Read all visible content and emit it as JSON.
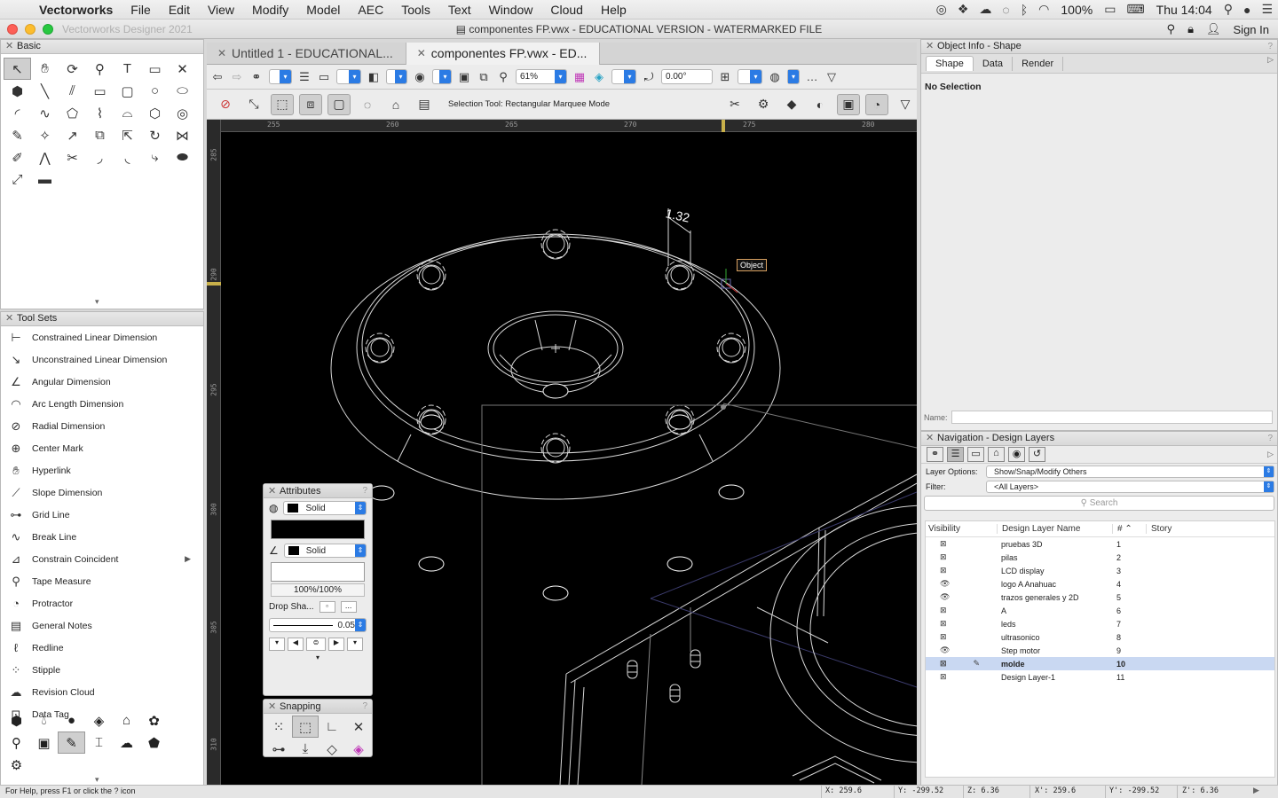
{
  "menubar": {
    "app": "Vectorworks",
    "items": [
      "File",
      "Edit",
      "View",
      "Modify",
      "Model",
      "AEC",
      "Tools",
      "Text",
      "Window",
      "Cloud",
      "Help"
    ],
    "battery": "100%",
    "clock": "Thu 14:04"
  },
  "titlebar": {
    "app_name": "Vectorworks Designer 2021",
    "doc_title": "componentes FP.vwx - EDUCATIONAL VERSION - WATERMARKED FILE",
    "sign_in": "Sign In"
  },
  "basic_palette": {
    "title": "Basic"
  },
  "toolsets": {
    "title": "Tool Sets",
    "items": [
      {
        "label": "Constrained Linear Dimension",
        "icon": "constrained-dimension-icon"
      },
      {
        "label": "Unconstrained Linear Dimension",
        "icon": "unconstrained-dimension-icon"
      },
      {
        "label": "Angular Dimension",
        "icon": "angular-dimension-icon"
      },
      {
        "label": "Arc Length Dimension",
        "icon": "arc-length-icon"
      },
      {
        "label": "Radial Dimension",
        "icon": "radial-dimension-icon"
      },
      {
        "label": "Center Mark",
        "icon": "center-mark-icon"
      },
      {
        "label": "Hyperlink",
        "icon": "hyperlink-icon"
      },
      {
        "label": "Slope Dimension",
        "icon": "slope-dimension-icon"
      },
      {
        "label": "Grid Line",
        "icon": "grid-line-icon"
      },
      {
        "label": "Break Line",
        "icon": "break-line-icon"
      },
      {
        "label": "Constrain Coincident",
        "icon": "constrain-icon"
      },
      {
        "label": "Tape Measure",
        "icon": "tape-measure-icon"
      },
      {
        "label": "Protractor",
        "icon": "protractor-icon"
      },
      {
        "label": "General Notes",
        "icon": "notes-icon"
      },
      {
        "label": "Redline",
        "icon": "redline-icon"
      },
      {
        "label": "Stipple",
        "icon": "stipple-icon"
      },
      {
        "label": "Revision Cloud",
        "icon": "revision-cloud-icon"
      },
      {
        "label": "Data Tag",
        "icon": "data-tag-icon"
      }
    ]
  },
  "tabs": [
    {
      "label": "Untitled 1 - EDUCATIONAL...",
      "active": false
    },
    {
      "label": "componentes FP.vwx - ED...",
      "active": true
    }
  ],
  "viewbar": {
    "zoom": "61%",
    "rotation": "0.00°"
  },
  "modebar": {
    "mode_text": "Selection Tool: Rectangular Marquee Mode"
  },
  "rulers": {
    "h": [
      "255",
      "260",
      "265",
      "270",
      "275",
      "280"
    ],
    "v": [
      "285",
      "290",
      "295",
      "300",
      "305",
      "310"
    ]
  },
  "canvas": {
    "dim_label": "1.32",
    "object_tip": "Object"
  },
  "attributes": {
    "title": "Attributes",
    "fill_style": "Solid",
    "pen_style": "Solid",
    "opacity": "100%/100%",
    "drop_shadow": "Drop Sha...",
    "drop_more": "...",
    "line_weight": "0.05"
  },
  "snapping": {
    "title": "Snapping"
  },
  "object_info": {
    "title": "Object Info - Shape",
    "tabs": [
      "Shape",
      "Data",
      "Render"
    ],
    "active_tab": "Shape",
    "status": "No Selection",
    "name_label": "Name:"
  },
  "navigation": {
    "title": "Navigation - Design Layers",
    "layer_options_label": "Layer Options:",
    "layer_options_value": "Show/Snap/Modify Others",
    "filter_label": "Filter:",
    "filter_value": "<All Layers>",
    "search_placeholder": "Search",
    "columns": [
      "Visibility",
      "Design Layer Name",
      "#",
      "Story"
    ],
    "layers": [
      {
        "name": "pruebas 3D",
        "num": "1",
        "vis": "hidden",
        "selected": false
      },
      {
        "name": "pilas",
        "num": "2",
        "vis": "hidden",
        "selected": false
      },
      {
        "name": "LCD display",
        "num": "3",
        "vis": "hidden",
        "selected": false
      },
      {
        "name": "logo A Anahuac",
        "num": "4",
        "vis": "visible",
        "selected": false
      },
      {
        "name": "trazos generales y 2D",
        "num": "5",
        "vis": "visible",
        "selected": false
      },
      {
        "name": "A",
        "num": "6",
        "vis": "hidden",
        "selected": false
      },
      {
        "name": "leds",
        "num": "7",
        "vis": "hidden",
        "selected": false
      },
      {
        "name": "ultrasonico",
        "num": "8",
        "vis": "hidden",
        "selected": false
      },
      {
        "name": "Step motor",
        "num": "9",
        "vis": "visible",
        "selected": false
      },
      {
        "name": "molde",
        "num": "10",
        "vis": "hidden",
        "selected": true
      },
      {
        "name": "Design Layer-1",
        "num": "11",
        "vis": "hidden",
        "selected": false
      }
    ]
  },
  "statusbar": {
    "help": "For Help, press F1 or click the ? icon",
    "x": "X: 259.6",
    "y": "Y: -299.52",
    "z": "Z: 6.36",
    "xp": "X': 259.6",
    "yp": "Y': -299.52",
    "zp": "Z': 6.36"
  }
}
